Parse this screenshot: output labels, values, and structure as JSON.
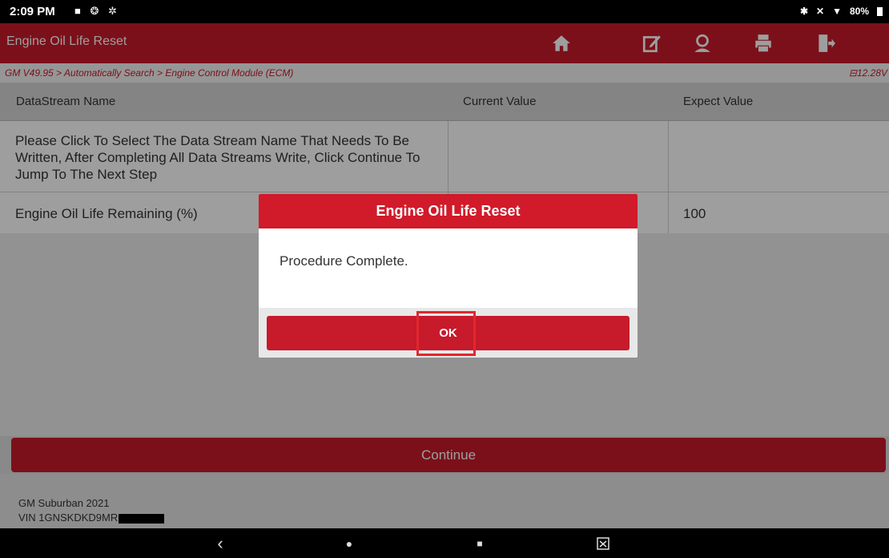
{
  "status_bar": {
    "time": "2:09 PM",
    "left_icons": "■ ❂ ✲",
    "battery": "80%"
  },
  "header": {
    "title": "Engine Oil Life Reset",
    "buttons": [
      "home-icon",
      "edit-icon",
      "user-icon",
      "print-icon",
      "exit-icon"
    ]
  },
  "breadcrumb": {
    "path": "GM V49.95 > Automatically Search > Engine Control Module (ECM)",
    "voltage": "12.28V"
  },
  "table": {
    "headers": [
      "DataStream Name",
      "Current Value",
      "Expect Value"
    ],
    "rows": [
      {
        "name": "Please Click To Select The Data Stream Name That Needs To Be Written, After Completing All Data Streams Write, Click Continue To Jump To The Next Step",
        "current": "",
        "expect": ""
      },
      {
        "name": "Engine Oil Life Remaining (%)",
        "current": "",
        "expect": "100"
      }
    ]
  },
  "continue_label": "Continue",
  "vehicle": {
    "model": "GM Suburban 2021",
    "vin": "VIN 1GNSKDKD9MR"
  },
  "dialog": {
    "title": "Engine Oil Life Reset",
    "message": "Procedure Complete.",
    "ok_label": "OK"
  },
  "nav": {
    "back": "‹",
    "home": "●",
    "recents": "■"
  },
  "colors": {
    "brand_red": "#c71a2b",
    "dialog_red": "#d11a2a"
  }
}
